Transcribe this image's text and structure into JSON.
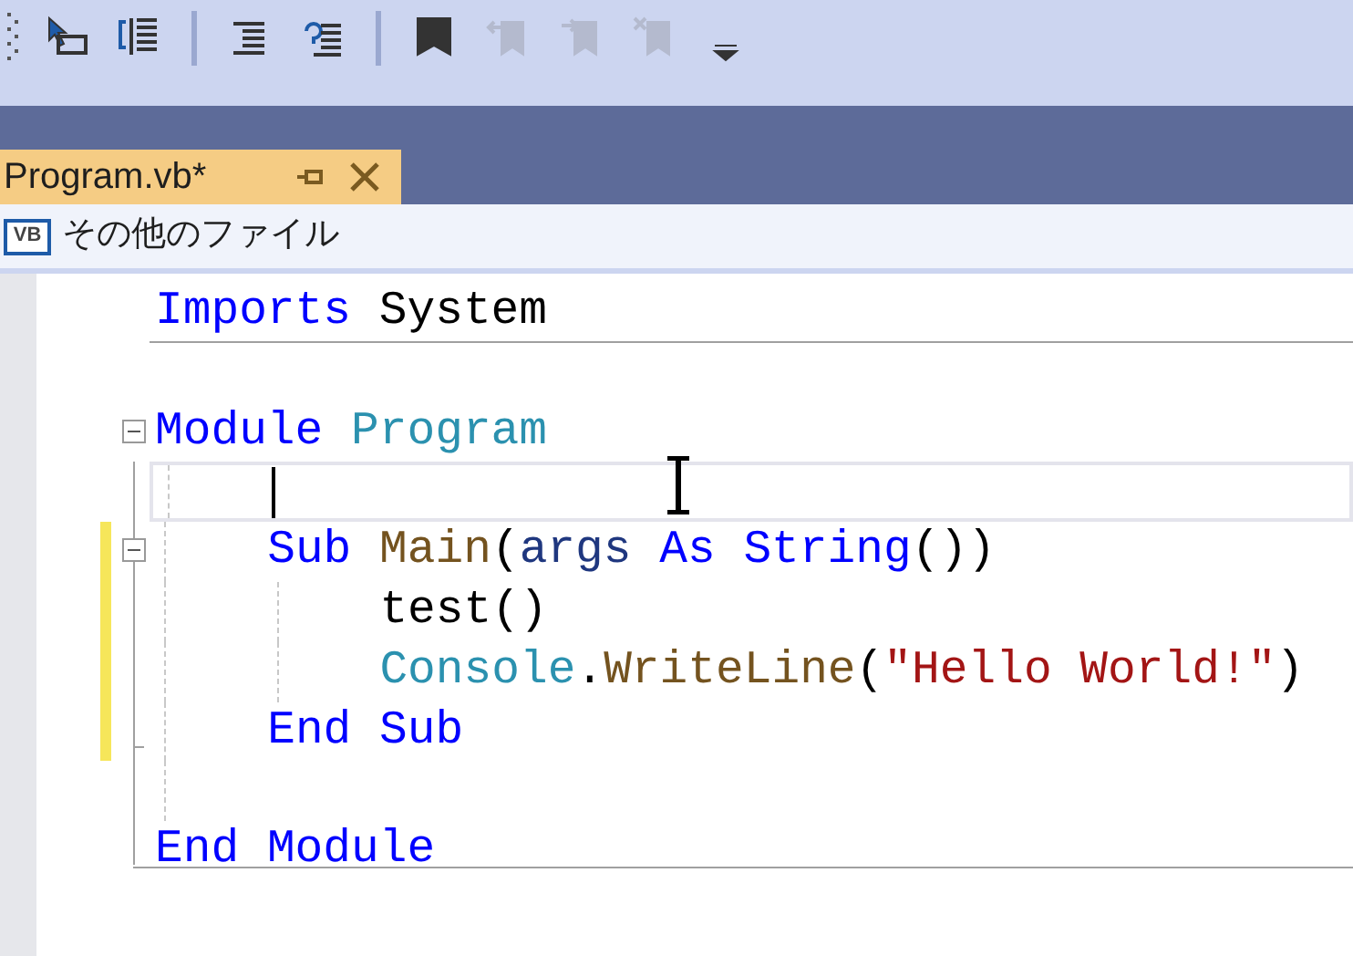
{
  "toolbar": [
    {
      "kind": "select-item",
      "disabled": false
    },
    {
      "kind": "outline",
      "disabled": false
    },
    {
      "kind": "separator"
    },
    {
      "kind": "indent",
      "disabled": false
    },
    {
      "kind": "unindent",
      "disabled": false
    },
    {
      "kind": "separator"
    },
    {
      "kind": "bookmark",
      "disabled": false
    },
    {
      "kind": "prev-bookmark",
      "disabled": true
    },
    {
      "kind": "next-bookmark",
      "disabled": true
    },
    {
      "kind": "clear-bookmark",
      "disabled": true
    },
    {
      "kind": "overflow",
      "disabled": false
    }
  ],
  "tabs": [
    {
      "label": "Program.vb*",
      "selected": true
    }
  ],
  "navigation_bar": {
    "file_type_icon": "VB",
    "project": "その他のファイル"
  },
  "editor": {
    "lines": [
      {
        "tokens": [
          {
            "text": "Imports ",
            "kind": "keyword"
          },
          {
            "text": "System",
            "kind": "plain"
          }
        ],
        "separator_below": true,
        "current": false
      },
      {
        "current": false
      },
      {
        "tokens": [
          {
            "text": "Module ",
            "kind": "keyword"
          },
          {
            "text": "Program",
            "kind": "type"
          }
        ],
        "expanded": true,
        "current": false,
        "children": [
          {
            "current": true
          },
          {
            "tokens": [
              {
                "text": "Sub ",
                "kind": "keyword"
              },
              {
                "text": "Main",
                "kind": "method"
              },
              {
                "text": "(",
                "kind": "plain"
              },
              {
                "text": "args ",
                "kind": "parameter"
              },
              {
                "text": "As ",
                "kind": "keyword"
              },
              {
                "text": "String",
                "kind": "keyword"
              },
              {
                "text": "())",
                "kind": "plain"
              }
            ],
            "expanded": true,
            "modified": true,
            "current": false,
            "children": [
              {
                "tokens": [
                  {
                    "text": "test()",
                    "kind": "plain"
                  }
                ],
                "modified": true,
                "current": false
              },
              {
                "tokens": [
                  {
                    "text": "Console",
                    "kind": "type"
                  },
                  {
                    "text": ".",
                    "kind": "plain"
                  },
                  {
                    "text": "WriteLine",
                    "kind": "method"
                  },
                  {
                    "text": "(",
                    "kind": "plain"
                  },
                  {
                    "text": "\"Hello World!\"",
                    "kind": "string"
                  },
                  {
                    "text": ")",
                    "kind": "plain"
                  }
                ],
                "modified": true,
                "current": false
              }
            ]
          },
          {
            "tokens": [
              {
                "text": "End ",
                "kind": "keyword"
              },
              {
                "text": "Sub",
                "kind": "keyword"
              }
            ],
            "modified": true,
            "block_end": true,
            "current": false
          },
          {
            "current": false
          }
        ]
      },
      {
        "tokens": [
          {
            "text": "End ",
            "kind": "keyword"
          },
          {
            "text": "Module",
            "kind": "keyword"
          }
        ],
        "block_end": true,
        "current": false
      }
    ]
  }
}
